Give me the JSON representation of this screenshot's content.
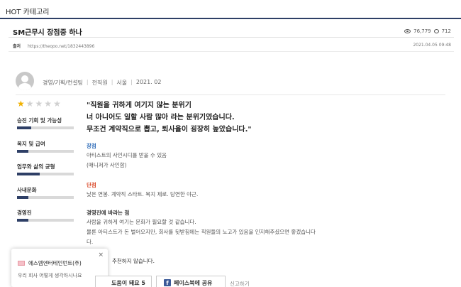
{
  "category_title": "HOT 카테고리",
  "post": {
    "title": "SM근무시 장점중 하나",
    "views": "76,779",
    "comments": "712",
    "source_label": "출처",
    "source_url": "https://theqoo.net/1832443896",
    "date": "2021.04.05 09:48"
  },
  "review": {
    "meta": [
      "경영/기획/컨설팅",
      "전직원",
      "서울",
      "2021. 02"
    ],
    "rating": 1,
    "rating_max": 5,
    "categories": [
      {
        "label": "승진 기회 및 가능성",
        "score": 0.25
      },
      {
        "label": "복지 및 급여",
        "score": 0.2
      },
      {
        "label": "업무와 삶의 균형",
        "score": 0.4
      },
      {
        "label": "사내문화",
        "score": 0.2
      },
      {
        "label": "경영진",
        "score": 0.2
      }
    ],
    "quote_lines": [
      "\"직원을 귀하게 여기지 않는 분위기",
      "너 아니어도 일할 사람 많아 라는 분위기였습니다.",
      "무조건 계약직으로 뽑고, 퇴사율이 굉장히 높았습니다.\""
    ],
    "pros_label": "장점",
    "pros_lines": [
      "아티스트의 사인시디를 받을 수 있음",
      "(매니저가 사인함)"
    ],
    "cons_label": "단점",
    "cons_lines": [
      "낮은 연봉. 계약직 스타트. 복지 제로. 당연한 야근."
    ],
    "wish_label": "경영진에 바라는 점",
    "wish_lines": [
      "사람을 귀하게 여기는 문화가 필요할 것 같습니다.",
      "물론 아티스트가 돈 벌어오지만, 회사를 뒷받침에는 직원들의 노고가 있음을 인지해주셨으면 좋겠습니다",
      "다."
    ],
    "recommend_text": "추천하지 않습니다."
  },
  "popup": {
    "company": "에스엠엔터테인먼트(주)",
    "question": "우리 회사 어떻게 생각하시나요",
    "close": "×"
  },
  "actions": {
    "help_label": "도움이 돼요 5",
    "facebook_label": "페이스북에 공유",
    "report_label": "신고하기"
  },
  "colors": {
    "accent": "#2e3f66",
    "star": "#f1b100",
    "pros": "#2d6bb8",
    "cons": "#d94423"
  }
}
